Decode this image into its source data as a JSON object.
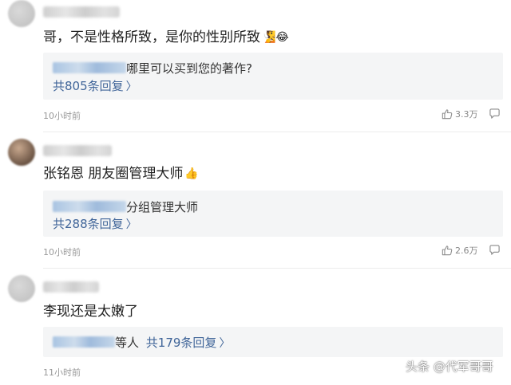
{
  "comments": [
    {
      "text": "哥，不是性格所致，是你的性别所致",
      "emojis": "🧏😂",
      "reply_preview": "哪里可以买到您的著作?",
      "reply_count": "共805条回复",
      "time": "10小时前",
      "likes": "3.3万"
    },
    {
      "text": "张铭恩 朋友圈管理大师",
      "emojis": "👍",
      "reply_preview": "分组管理大师",
      "reply_count": "共288条回复",
      "time": "10小时前",
      "likes": "2.6万"
    },
    {
      "text": "李现还是太嫩了",
      "reply_preview": "等人",
      "reply_count": "共179条回复",
      "time": "11小时前"
    }
  ],
  "watermark": "头条 @代军哥哥",
  "icons": {
    "like": "thumbs-up-icon",
    "comment": "comment-bubble-icon",
    "chevron": "chevron-right-icon"
  }
}
